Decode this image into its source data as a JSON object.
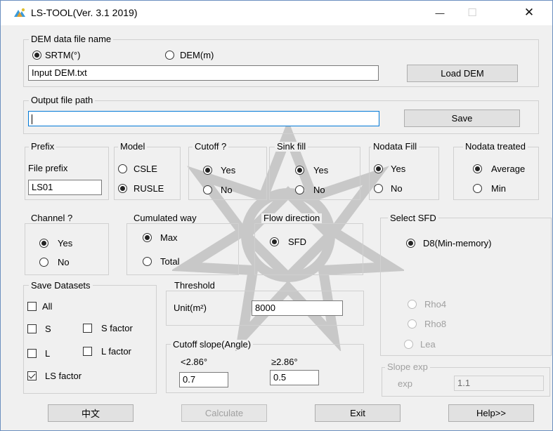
{
  "window": {
    "title": "LS-TOOL(Ver. 3.1 2019)",
    "minimize_glyph": "—",
    "maximize_glyph": "☐",
    "close_glyph": "✕"
  },
  "dem": {
    "legend": "DEM data file name",
    "srtm_label": "SRTM(°)",
    "srtm_selected": true,
    "dem_label": "DEM(m)",
    "dem_selected": false,
    "input_value": "Input DEM.txt",
    "load_button": "Load DEM"
  },
  "output": {
    "legend": "Output file path",
    "path_value": "",
    "save_button": "Save"
  },
  "prefix": {
    "legend": "Prefix",
    "label": "File prefix",
    "value": "LS01"
  },
  "model": {
    "legend": "Model",
    "options": [
      "CSLE",
      "RUSLE"
    ],
    "selected": "RUSLE"
  },
  "cutoff": {
    "legend": "Cutoff ?",
    "options": [
      "Yes",
      "No"
    ],
    "selected": "Yes"
  },
  "sink_fill": {
    "legend": "Sink fill",
    "options": [
      "Yes",
      "No"
    ],
    "selected": "Yes"
  },
  "nodata_fill": {
    "legend": "Nodata Fill",
    "options": [
      "Yes",
      "No"
    ],
    "selected": "Yes"
  },
  "nodata_treated": {
    "legend": "Nodata treated",
    "options": [
      "Average",
      "Min"
    ],
    "selected": "Average"
  },
  "channel": {
    "legend": "Channel ?",
    "options": [
      "Yes",
      "No"
    ],
    "selected": "Yes"
  },
  "cumulated": {
    "legend": "Cumulated way",
    "options": [
      "Max",
      "Total"
    ],
    "selected": "Max"
  },
  "flow_direction": {
    "legend": "Flow direction",
    "option": "SFD",
    "selected": true
  },
  "select_sfd": {
    "legend": "Select SFD",
    "options": [
      "D8(Min-memory)",
      "Rho4",
      "Rho8",
      "Lea"
    ],
    "selected": "D8(Min-memory)"
  },
  "slope_exp": {
    "legend": "Slope exp",
    "label": "exp",
    "value": "1.1"
  },
  "save_datasets": {
    "legend": "Save Datasets",
    "items": [
      {
        "label": "All",
        "checked": false
      },
      {
        "label": "S",
        "checked": false
      },
      {
        "label": "S factor",
        "checked": false
      },
      {
        "label": "L",
        "checked": false
      },
      {
        "label": "L factor",
        "checked": false
      },
      {
        "label": "LS factor",
        "checked": true
      }
    ]
  },
  "threshold": {
    "legend": "Threshold",
    "unit_label": "Unit(m²)",
    "value": "8000"
  },
  "cutoff_slope": {
    "legend": "Cutoff slope(Angle)",
    "lt_label": "<2.86°",
    "lt_value": "0.7",
    "ge_label": "≥2.86°",
    "ge_value": "0.5"
  },
  "buttons": {
    "chinese": "中文",
    "calculate": "Calculate",
    "exit": "Exit",
    "help": "Help>>"
  },
  "colors": {
    "window_bg": "#f0f0f0",
    "focus_border": "#0078d7",
    "disabled_text": "#a0a0a0"
  }
}
